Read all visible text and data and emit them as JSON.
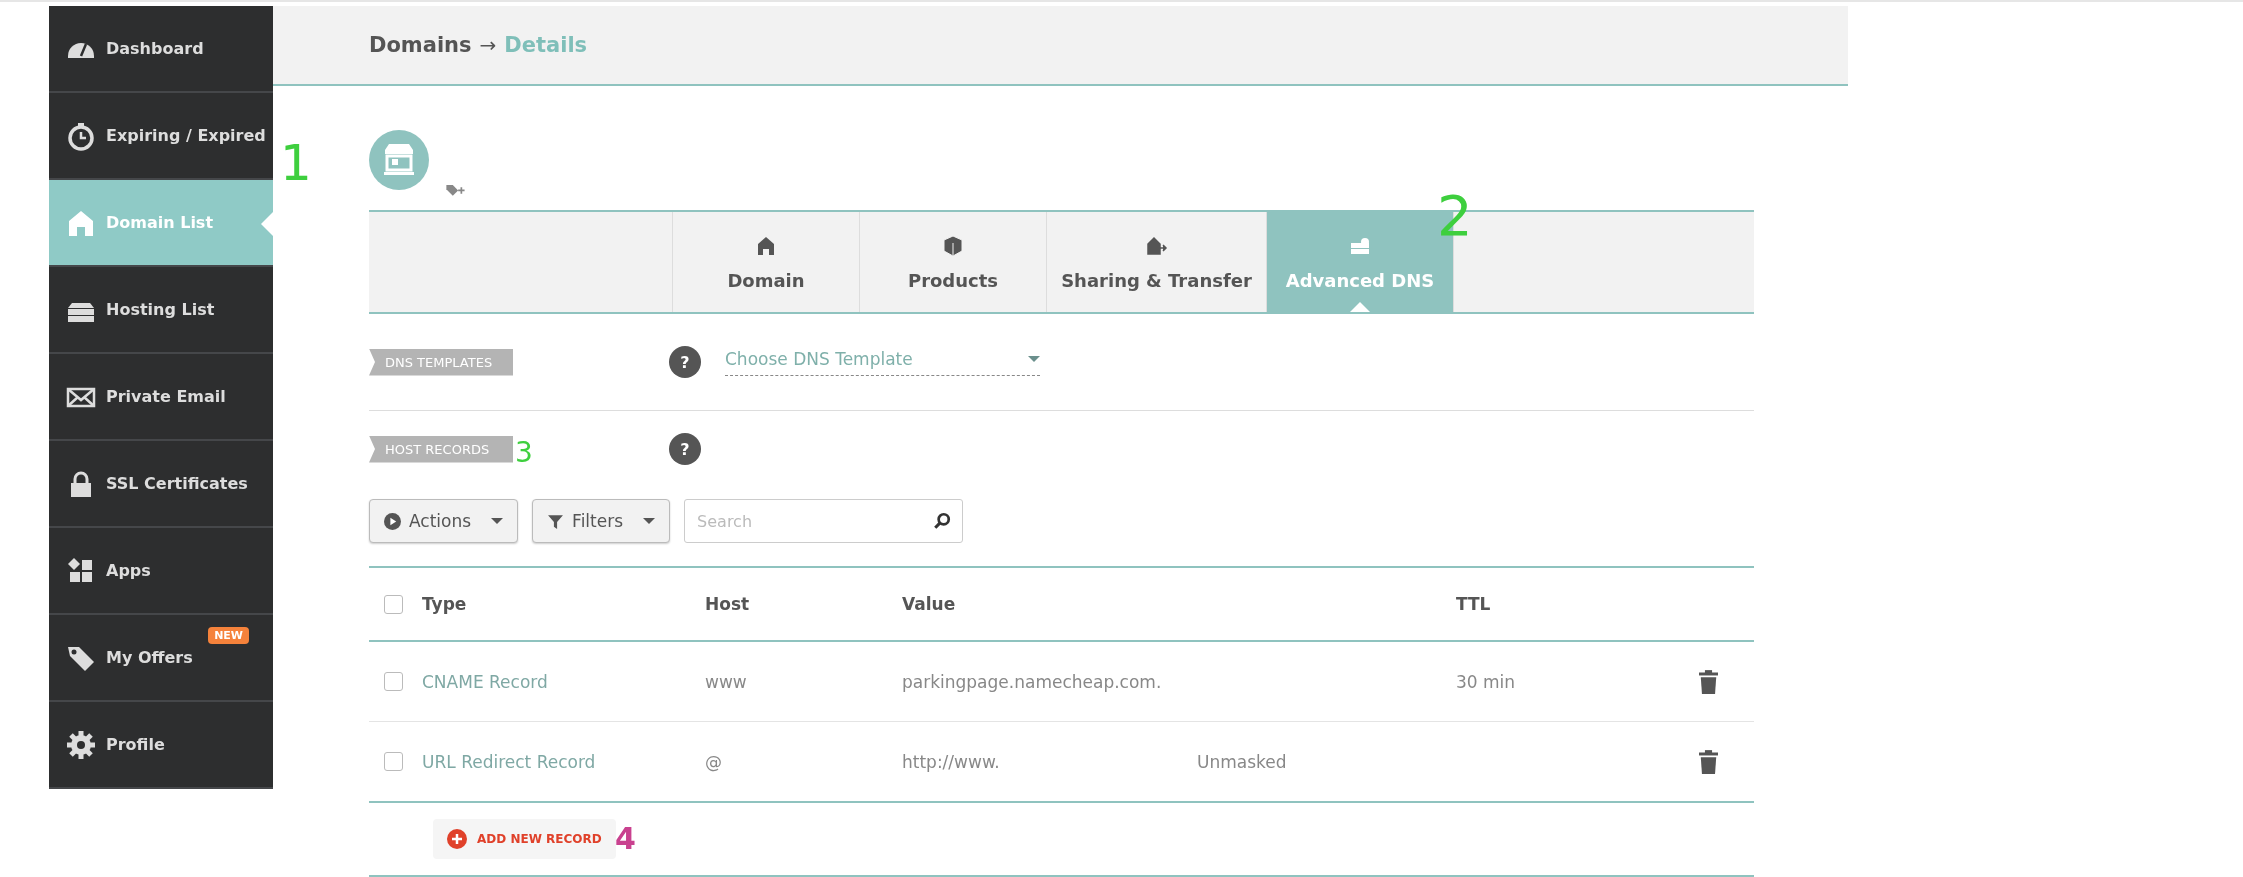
{
  "sidebar": {
    "items": [
      {
        "label": "Dashboard",
        "selected": false
      },
      {
        "label": "Expiring / Expired",
        "selected": false
      },
      {
        "label": "Domain List",
        "selected": true
      },
      {
        "label": "Hosting List",
        "selected": false
      },
      {
        "label": "Private Email",
        "selected": false
      },
      {
        "label": "SSL Certificates",
        "selected": false
      },
      {
        "label": "Apps",
        "selected": false
      },
      {
        "label": "My Offers",
        "selected": false,
        "badge": "NEW"
      },
      {
        "label": "Profile",
        "selected": false
      }
    ]
  },
  "breadcrumb": {
    "parent": "Domains",
    "separator": "→",
    "current": "Details"
  },
  "tabs": [
    {
      "label": "Domain",
      "selected": false
    },
    {
      "label": "Products",
      "selected": false
    },
    {
      "label": "Sharing & Transfer",
      "selected": false
    },
    {
      "label": "Advanced DNS",
      "selected": true
    }
  ],
  "dns_templates": {
    "label": "DNS TEMPLATES",
    "help": "?",
    "placeholder": "Choose DNS Template"
  },
  "host_records": {
    "label": "HOST RECORDS",
    "help": "?"
  },
  "toolbar": {
    "actions": "Actions",
    "filters": "Filters",
    "search_placeholder": "Search"
  },
  "table": {
    "select_all_checked": false,
    "columns": [
      "Type",
      "Host",
      "Value",
      "TTL"
    ],
    "rows": [
      {
        "checked": false,
        "type": "CNAME Record",
        "host": "www",
        "value": "parkingpage.namecheap.com.",
        "extra": "",
        "ttl": "30 min"
      },
      {
        "checked": false,
        "type": "URL Redirect Record",
        "host": "@",
        "value": "http://www.",
        "extra": "Unmasked",
        "ttl": ""
      }
    ]
  },
  "add_record": "ADD NEW RECORD",
  "annotations": [
    {
      "text": "1",
      "color": "#3ecf3e"
    },
    {
      "text": "2",
      "color": "#3ecf3e"
    },
    {
      "text": "3",
      "color": "#3ecf3e"
    },
    {
      "text": "4",
      "color": "#c9418f"
    }
  ]
}
